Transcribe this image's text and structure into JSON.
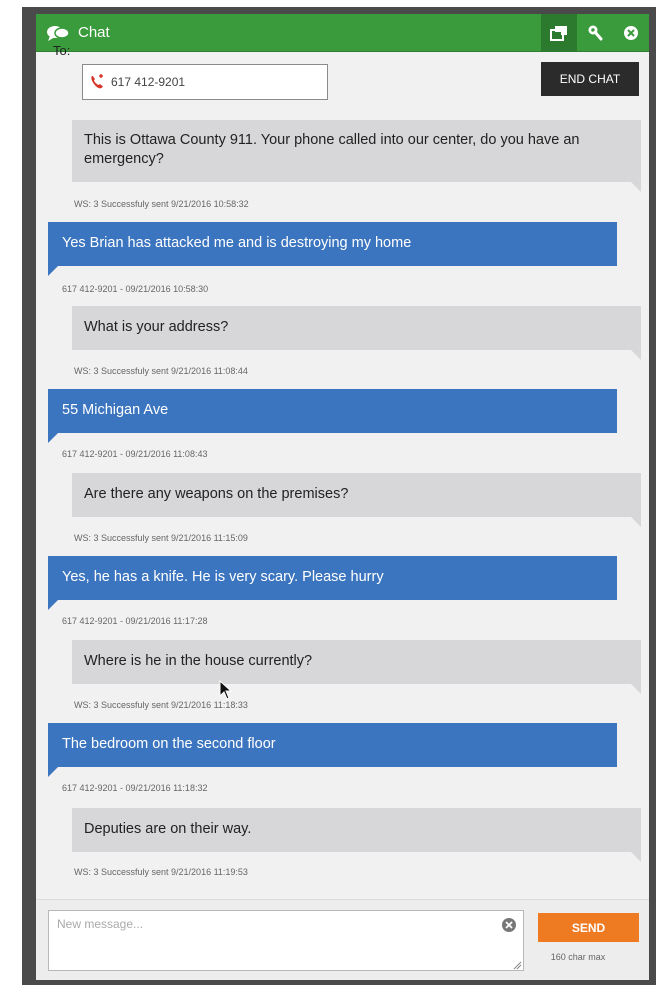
{
  "window": {
    "title": "Chat"
  },
  "toolbar": {
    "buttons": [
      {
        "icon": "transfer-icon",
        "active": true
      },
      {
        "icon": "wrench-icon",
        "active": false
      },
      {
        "icon": "close-icon",
        "active": false
      }
    ]
  },
  "to": {
    "label": "To:",
    "value": "617 412-9201"
  },
  "end_chat": {
    "label": "END CHAT"
  },
  "messages": [
    {
      "direction": "out",
      "text": "This is Ottawa County 911. Your phone called into our center, do you have an emergency?",
      "meta": "WS: 3 Successfuly sent 9/21/2016 10:58:32"
    },
    {
      "direction": "in",
      "text": "Yes Brian has attacked me and is destroying my home",
      "meta": "617 412-9201 - 09/21/2016 10:58:30"
    },
    {
      "direction": "out",
      "text": "What is your address?",
      "meta": "WS: 3 Successfuly sent 9/21/2016 11:08:44"
    },
    {
      "direction": "in",
      "text": "55 Michigan Ave",
      "meta": "617 412-9201 - 09/21/2016 11:08:43"
    },
    {
      "direction": "out",
      "text": "Are there any weapons on the premises?",
      "meta": "WS: 3 Successfuly sent 9/21/2016 11:15:09"
    },
    {
      "direction": "in",
      "text": "Yes, he has a knife. He is very scary. Please hurry",
      "meta": "617 412-9201 - 09/21/2016 11:17:28"
    },
    {
      "direction": "out",
      "text": "Where is he in the house currently?",
      "meta": "WS: 3 Successfuly sent 9/21/2016 11:18:33"
    },
    {
      "direction": "in",
      "text": "The bedroom on the second floor",
      "meta": "617 412-9201 - 09/21/2016 11:18:32"
    },
    {
      "direction": "out",
      "text": "Deputies are on their way.",
      "meta": "WS: 3 Successfuly sent 9/21/2016 11:19:53"
    }
  ],
  "composer": {
    "placeholder": "New message...",
    "send_label": "SEND",
    "char_limit": "160 char max"
  },
  "colors": {
    "titlebar": "#3a9b3c",
    "incoming": "#3c75bf",
    "outgoing": "#d7d7d9",
    "send": "#ee7a22"
  }
}
